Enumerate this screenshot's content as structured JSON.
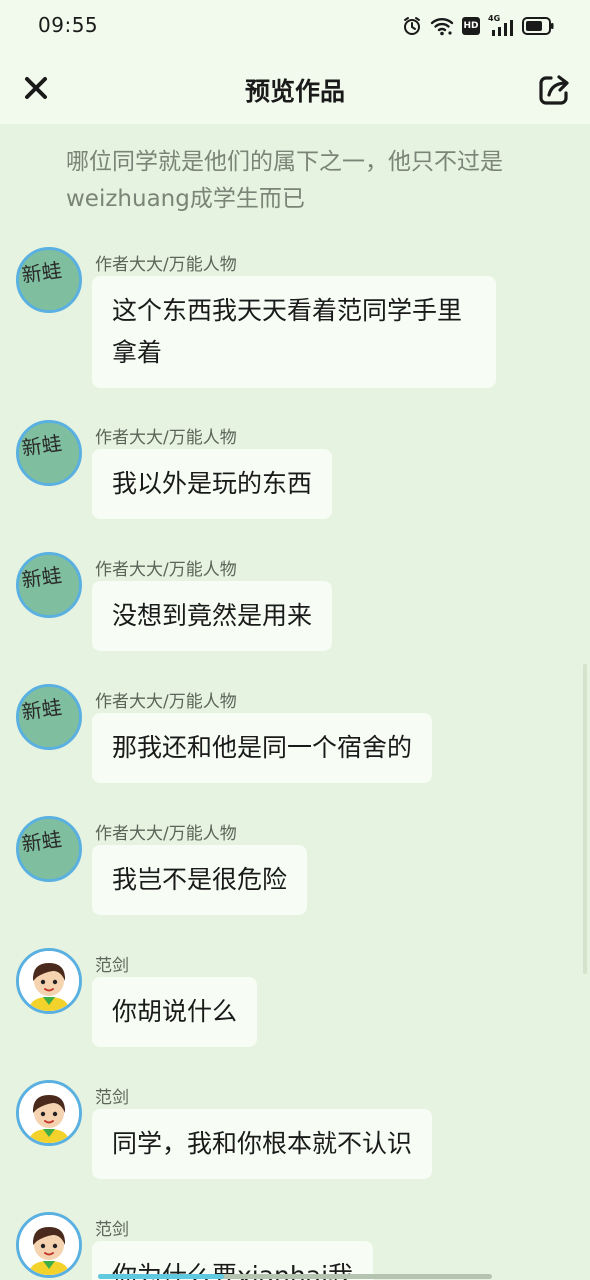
{
  "status_bar": {
    "time": "09:55",
    "icons": [
      "alarm-icon",
      "wifi-icon",
      "hd-icon",
      "signal-4g-icon",
      "battery-icon"
    ],
    "hd_label": "HD",
    "network_label": "4G"
  },
  "nav": {
    "title": "预览作品",
    "close_icon": "close-icon",
    "share_icon": "share-icon"
  },
  "narration": "哪位同学就是他们的属下之一，他只不过是weizhuang成学生而已",
  "messages": [
    {
      "speaker": "作者大大/万能人物",
      "avatar": "text-avatar",
      "text": "这个东西我天天看着范同学手里拿着"
    },
    {
      "speaker": "作者大大/万能人物",
      "avatar": "text-avatar",
      "text": "我以外是玩的东西"
    },
    {
      "speaker": "作者大大/万能人物",
      "avatar": "text-avatar",
      "text": "没想到竟然是用来"
    },
    {
      "speaker": "作者大大/万能人物",
      "avatar": "text-avatar",
      "text": "那我还和他是同一个宿舍的"
    },
    {
      "speaker": "作者大大/万能人物",
      "avatar": "text-avatar",
      "text": "我岂不是很危险"
    },
    {
      "speaker": "范剑",
      "avatar": "cartoon-boy-avatar",
      "text": "你胡说什么"
    },
    {
      "speaker": "范剑",
      "avatar": "cartoon-boy-avatar",
      "text": "同学，我和你根本就不认识"
    },
    {
      "speaker": "范剑",
      "avatar": "cartoon-boy-avatar",
      "text": "你为什么要xianhai我"
    }
  ],
  "avatar_text": "新蛙",
  "colors": {
    "background": "#e6f3e0",
    "header": "#f1faec",
    "bubble": "#f7fcf4",
    "avatar_ring": "#5ab0e0",
    "avatar_green": "#7fbf9f"
  }
}
